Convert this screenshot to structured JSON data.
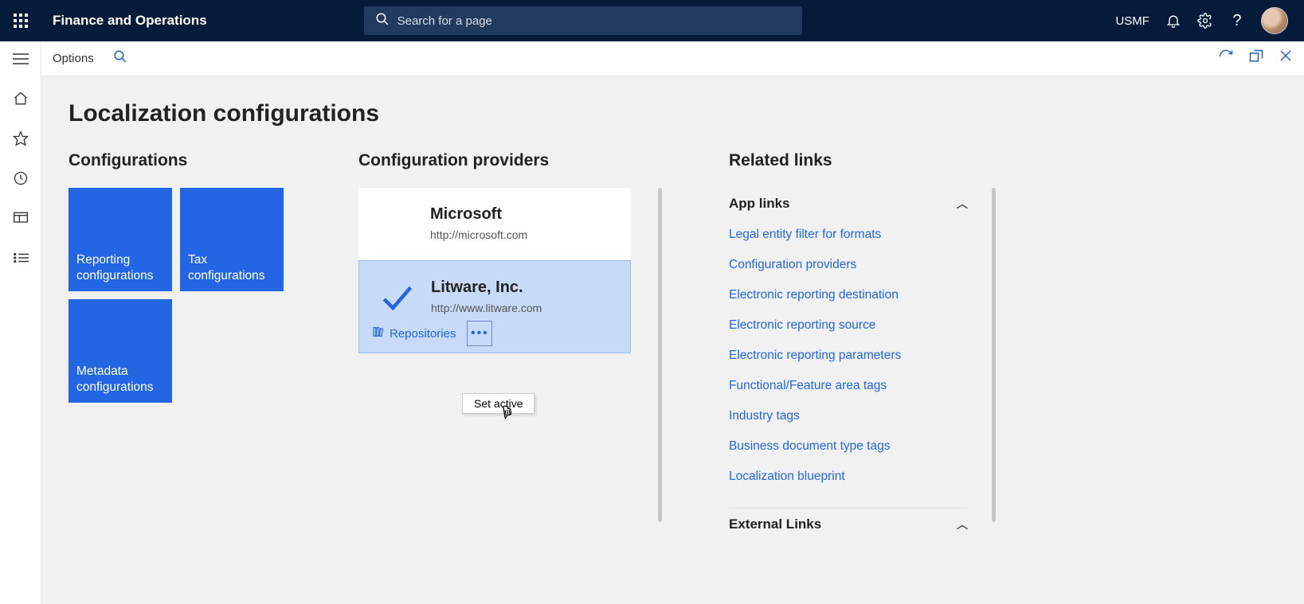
{
  "header": {
    "app_title": "Finance and Operations",
    "search_placeholder": "Search for a page",
    "entity": "USMF"
  },
  "actionbar": {
    "options": "Options"
  },
  "page": {
    "title": "Localization configurations"
  },
  "configurations": {
    "heading": "Configurations",
    "tiles": [
      "Reporting configurations",
      "Tax configurations",
      "Metadata configurations"
    ]
  },
  "providers": {
    "heading": "Configuration providers",
    "items": [
      {
        "name": "Microsoft",
        "url": "http://microsoft.com",
        "active": false
      },
      {
        "name": "Litware, Inc.",
        "url": "http://www.litware.com",
        "active": true
      }
    ],
    "repositories_label": "Repositories",
    "context_menu_item": "Set active"
  },
  "related": {
    "heading": "Related links",
    "groups": [
      {
        "title": "App links",
        "links": [
          "Legal entity filter for formats",
          "Configuration providers",
          "Electronic reporting destination",
          "Electronic reporting source",
          "Electronic reporting parameters",
          "Functional/Feature area tags",
          "Industry tags",
          "Business document type tags",
          "Localization blueprint"
        ]
      },
      {
        "title": "External Links",
        "links": []
      }
    ]
  }
}
